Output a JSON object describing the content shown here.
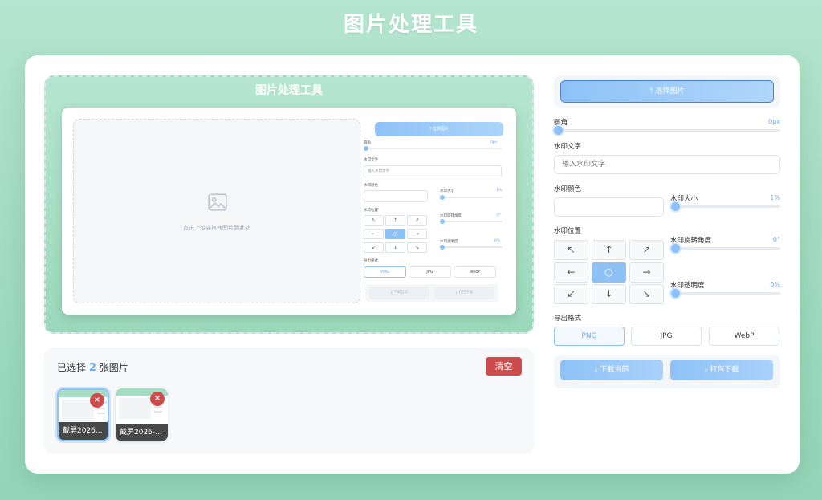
{
  "app": {
    "title": "图片处理工具"
  },
  "preview": {
    "title": "图片处理工具",
    "drop_text": "点击上传或拖拽图片到此处",
    "mini": {
      "upload_label": "选择图片",
      "radius_label": "圆角",
      "radius_value": "0px",
      "wm_text_label": "水印文字",
      "wm_text_placeholder": "输入水印文字",
      "wm_color_label": "水印颜色",
      "wm_size_label": "水印大小",
      "wm_size_value": "1%",
      "wm_pos_label": "水印位置",
      "wm_rot_label": "水印旋转角度",
      "wm_rot_value": "0°",
      "wm_op_label": "水印透明度",
      "wm_op_value": "0%",
      "export_label": "导出格式",
      "formats": [
        "PNG",
        "JPG",
        "WebP"
      ],
      "dl_current": "下载当前",
      "dl_pack": "打包下载"
    }
  },
  "selection": {
    "prefix": "已选择",
    "count": "2",
    "suffix": "张图片",
    "clear_label": "清空",
    "thumbs": [
      {
        "name": "截屏2026..."
      },
      {
        "name": "截屏2026-..."
      }
    ]
  },
  "controls": {
    "upload_label": "选择图片",
    "radius": {
      "label": "圆角",
      "value": "0px"
    },
    "wm_text": {
      "label": "水印文字",
      "placeholder": "输入水印文字"
    },
    "wm_color": {
      "label": "水印颜色"
    },
    "wm_size": {
      "label": "水印大小",
      "value": "1%"
    },
    "wm_pos": {
      "label": "水印位置",
      "buttons": [
        "↖",
        "↑",
        "↗",
        "←",
        "○",
        "→",
        "↙",
        "↓",
        "↘"
      ]
    },
    "wm_rotation": {
      "label": "水印旋转角度",
      "value": "0°"
    },
    "wm_opacity": {
      "label": "水印透明度",
      "value": "0%"
    },
    "export": {
      "label": "导出格式",
      "formats": [
        "PNG",
        "JPG",
        "WebP"
      ]
    },
    "download_current": "下载当前",
    "download_pack": "打包下载"
  },
  "colors": {
    "accent": "#8ec2f7",
    "danger": "#cd4b4b",
    "accent_text": "#6ba9f2"
  }
}
